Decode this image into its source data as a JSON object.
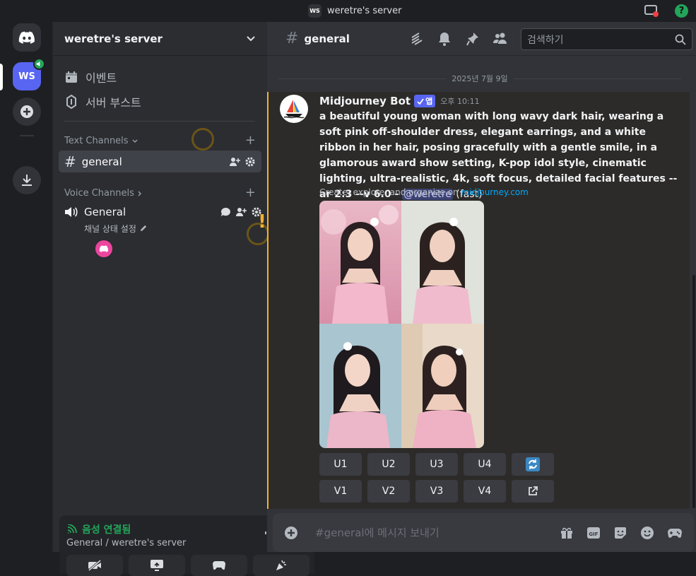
{
  "window": {
    "title": "weretre's server",
    "badge": "WS"
  },
  "guild": {
    "badge": "WS"
  },
  "sidebar": {
    "server_name": "weretre's server",
    "events_label": "이벤트",
    "boost_label": "서버 부스트",
    "text_category": "Text Channels",
    "voice_category": "Voice Channels",
    "general_channel": "general",
    "voice_channel": "General",
    "voice_status": "채널 상태 설정"
  },
  "voice_panel": {
    "status": "음성 연결됨",
    "location": "General / weretre's server"
  },
  "header": {
    "channel": "general",
    "search_placeholder": "검색하기"
  },
  "chat": {
    "date": "2025년 7월 9일",
    "author": "Midjourney Bot",
    "app_tag": "앱",
    "time": "오후 10:11",
    "prompt": "a beautiful young woman with long wavy dark hair, wearing a soft pink off-shoulder dress, elegant earrings, and a white ribbon in her hair, posing gracefully with a gentle smile, in a glamorous award show setting, K-pop idol style, cinematic lighting, ultra-realistic, 4k, soft focus, detailed facial features --ar 2:3 --v 6.0",
    "separator": " - ",
    "mention": "@weretre",
    "mode": " (fast)",
    "sub_prefix": "Create, explore, and organize on ",
    "sub_link": "midjourney.com",
    "upscale_buttons": [
      "U1",
      "U2",
      "U3",
      "U4"
    ],
    "variation_buttons": [
      "V1",
      "V2",
      "V3",
      "V4"
    ]
  },
  "composer": {
    "placeholder": "#general에 메시지 보내기"
  },
  "colors": {
    "accent": "#5865f2",
    "green": "#23a55a",
    "highlight": "#f0b232",
    "pink": "#eb459e",
    "link": "#00a8fc"
  }
}
